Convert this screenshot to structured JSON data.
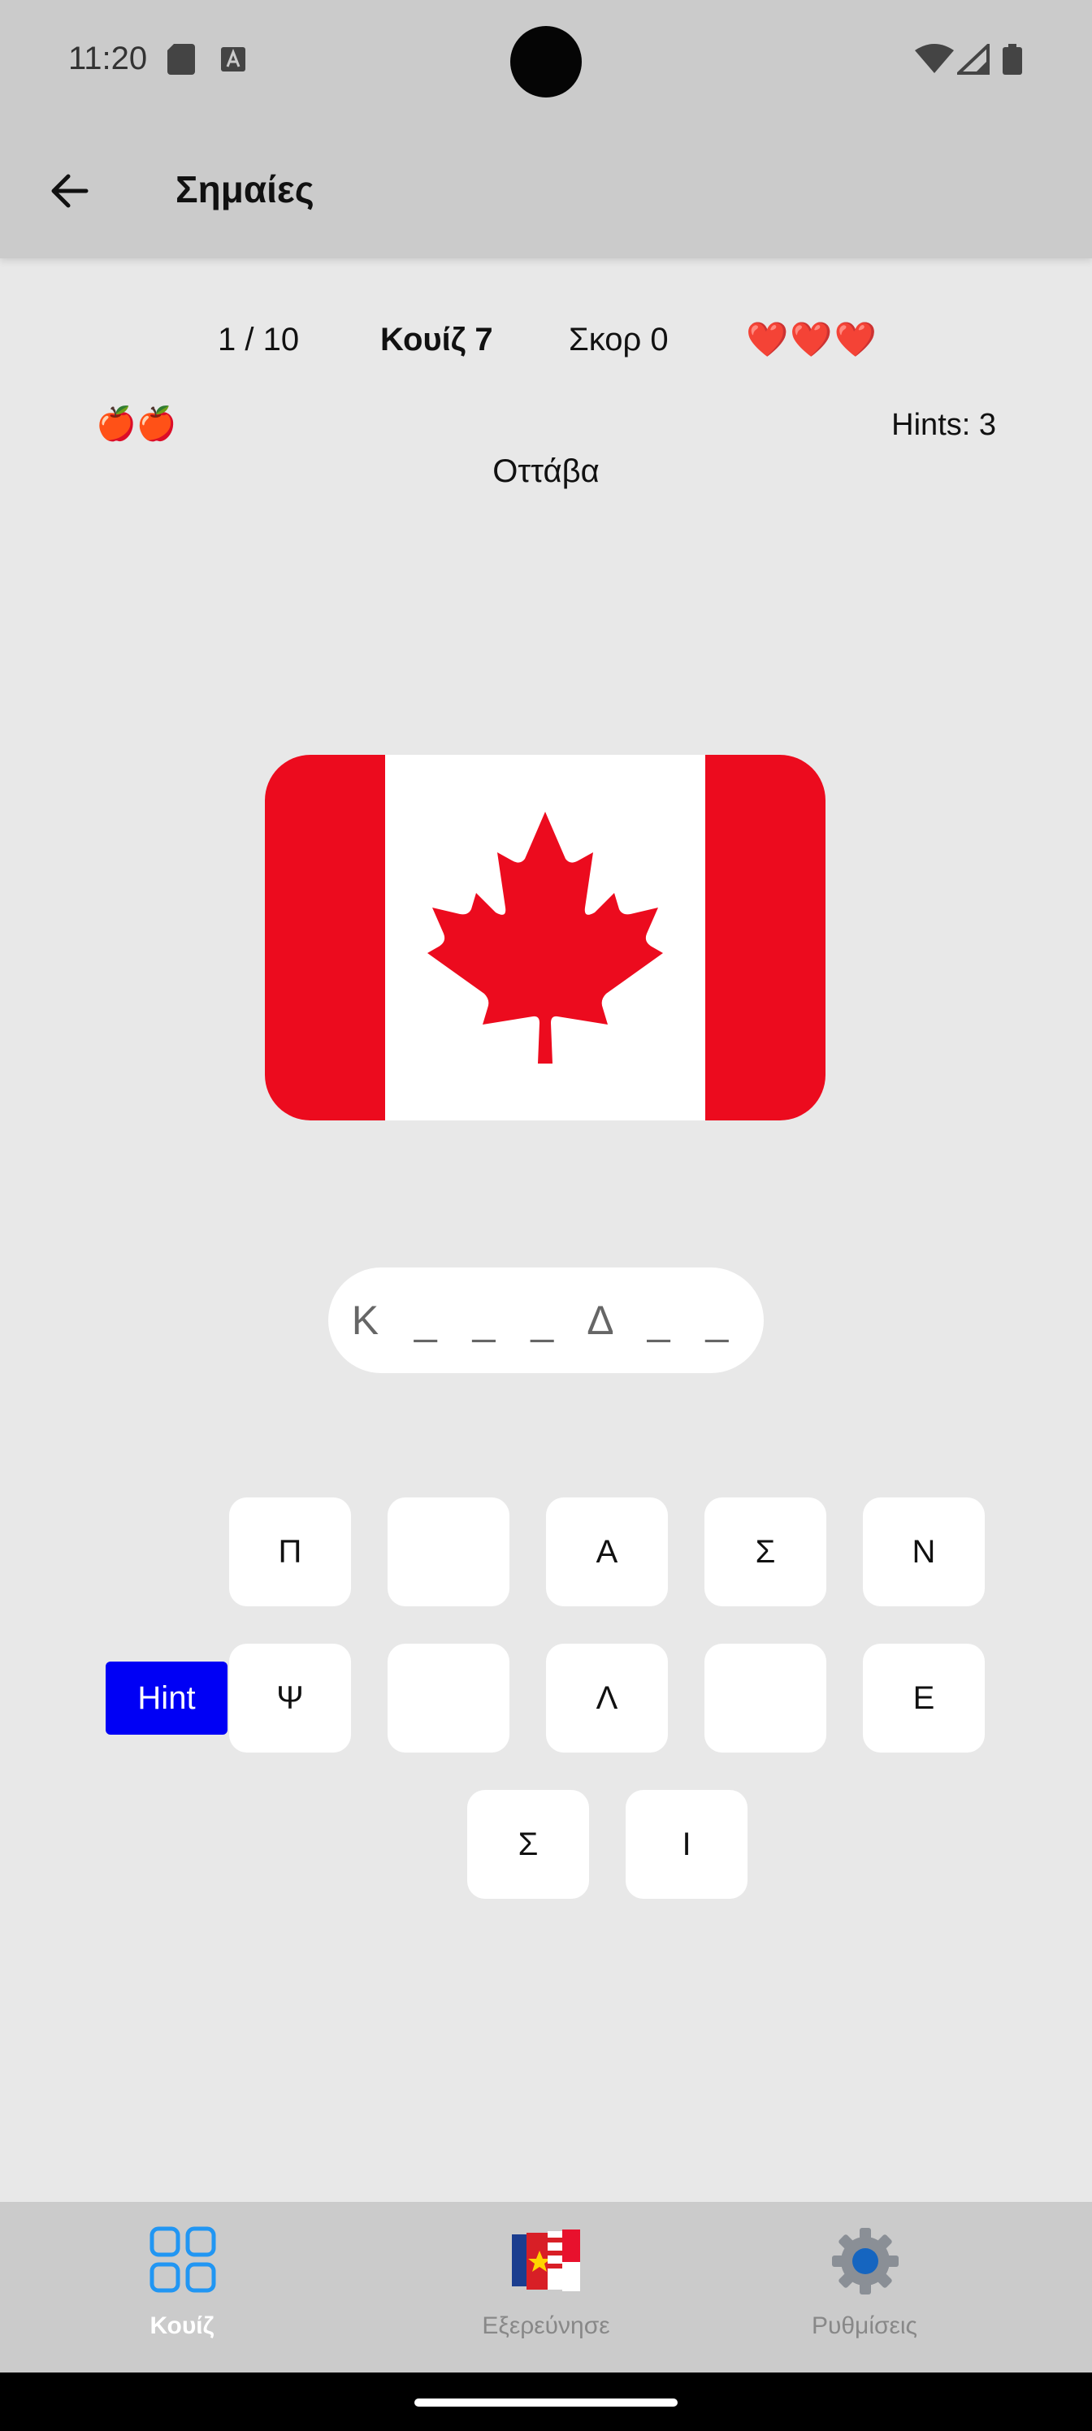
{
  "status_bar": {
    "time": "11:20"
  },
  "app_bar": {
    "title": "Σημαίες",
    "back_icon": "arrow-left-icon"
  },
  "quiz": {
    "progress": "1 / 10",
    "quiz_name": "Κουίζ 7",
    "score": "Σκορ 0",
    "hearts": "❤️❤️❤️",
    "apples": "🍎🍎",
    "hints": "Hints: 3",
    "capital": "Οττάβα",
    "answer": "Κ _ _ _ Δ _ _"
  },
  "keys": {
    "row1": [
      "Π",
      "",
      "Α",
      "Σ",
      "Ν"
    ],
    "row2": [
      "Ψ",
      "",
      "Λ",
      "",
      "Ε"
    ],
    "row3": [
      "Σ",
      "Ι"
    ]
  },
  "hint_button": "Hint",
  "bottom_nav": {
    "quiz": "Κουίζ",
    "explore": "Εξερεύνησε",
    "settings": "Ρυθμίσεις"
  },
  "colors": {
    "flag_red": "#ec0b1e",
    "hint_button_bg": "#0000f5",
    "nav_active": "#2196f3"
  }
}
